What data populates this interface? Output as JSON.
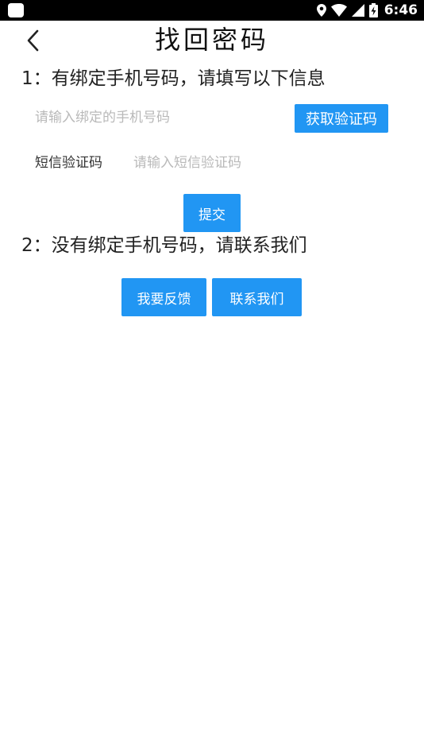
{
  "status_bar": {
    "time": "6:46",
    "icons": [
      "app-icon",
      "location-icon",
      "wifi-icon",
      "signal-icon",
      "battery-charging-icon"
    ]
  },
  "header": {
    "back_icon": "chevron-left-icon",
    "title": "找回密码"
  },
  "section1": {
    "heading": "1：有绑定手机号码，请填写以下信息",
    "phone_input": {
      "placeholder": "请输入绑定的手机号码",
      "value": ""
    },
    "get_code_button": "获取验证码",
    "sms_label": "短信验证码",
    "sms_input": {
      "placeholder": "请输入短信验证码",
      "value": ""
    },
    "submit_button": "提交"
  },
  "section2": {
    "heading": "2：没有绑定手机号码，请联系我们",
    "feedback_button": "我要反馈",
    "contact_button": "联系我们"
  },
  "colors": {
    "accent": "#2196f3",
    "status_bar": "#000000",
    "background": "#ffffff",
    "placeholder": "#b9b9b9"
  }
}
